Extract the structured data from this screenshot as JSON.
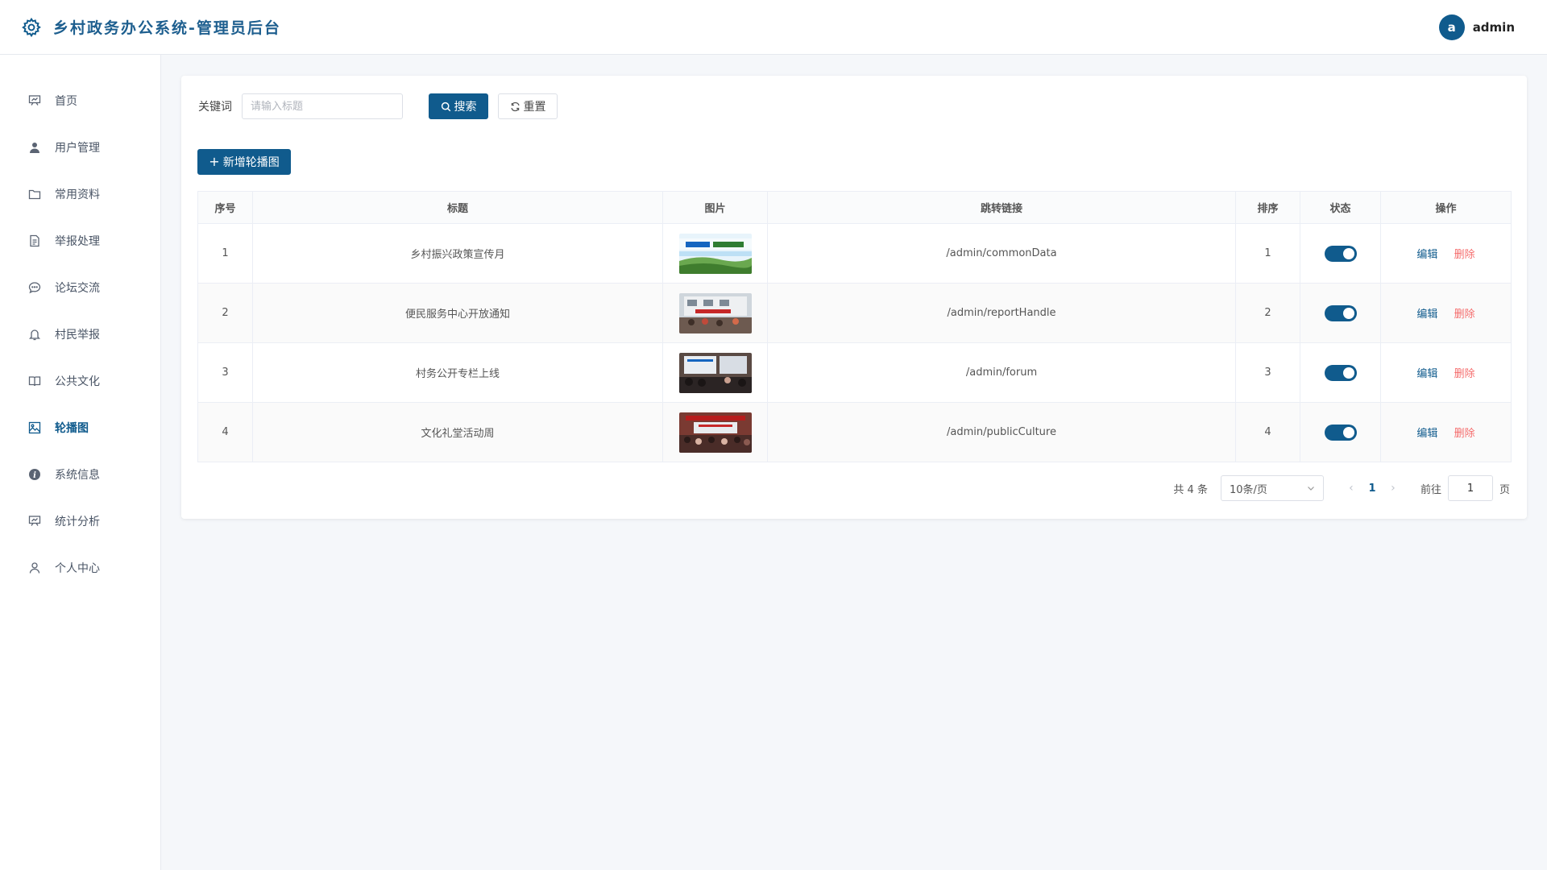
{
  "header": {
    "title": "乡村政务办公系统-管理员后台",
    "avatar_letter": "a",
    "username": "admin"
  },
  "sidebar": {
    "items": [
      {
        "label": "首页",
        "icon": "presentation-board-icon",
        "active": false
      },
      {
        "label": "用户管理",
        "icon": "user-filled-icon",
        "active": false
      },
      {
        "label": "常用资料",
        "icon": "folder-icon",
        "active": false
      },
      {
        "label": "举报处理",
        "icon": "document-icon",
        "active": false
      },
      {
        "label": "论坛交流",
        "icon": "chat-bubble-icon",
        "active": false
      },
      {
        "label": "村民举报",
        "icon": "bell-icon",
        "active": false
      },
      {
        "label": "公共文化",
        "icon": "book-icon",
        "active": false
      },
      {
        "label": "轮播图",
        "icon": "picture-icon",
        "active": true
      },
      {
        "label": "系统信息",
        "icon": "info-circle-icon",
        "active": false
      },
      {
        "label": "统计分析",
        "icon": "presentation-board-icon",
        "active": false
      },
      {
        "label": "个人中心",
        "icon": "user-outline-icon",
        "active": false
      }
    ]
  },
  "search": {
    "label": "关键词",
    "placeholder": "请输入标题",
    "value": "",
    "search_button": "搜索",
    "reset_button": "重置"
  },
  "toolbar": {
    "add_button": "新增轮播图"
  },
  "table": {
    "columns": [
      "序号",
      "标题",
      "图片",
      "跳转链接",
      "排序",
      "状态",
      "操作"
    ],
    "rows": [
      {
        "index": "1",
        "title": "乡村振兴政策宣传月",
        "image": "banner-policy",
        "link": "/admin/commonData",
        "sort": "1",
        "enabled": true
      },
      {
        "index": "2",
        "title": "便民服务中心开放通知",
        "image": "banner-service",
        "link": "/admin/reportHandle",
        "sort": "2",
        "enabled": true
      },
      {
        "index": "3",
        "title": "村务公开专栏上线",
        "image": "banner-meeting",
        "link": "/admin/forum",
        "sort": "3",
        "enabled": true
      },
      {
        "index": "4",
        "title": "文化礼堂活动周",
        "image": "banner-hall",
        "link": "/admin/publicCulture",
        "sort": "4",
        "enabled": true
      }
    ],
    "edit_label": "编辑",
    "delete_label": "删除"
  },
  "pagination": {
    "total_text": "共 4 条",
    "page_size": "10条/页",
    "current_page": "1",
    "goto_label": "前往",
    "goto_value": "1",
    "page_unit": "页"
  },
  "colors": {
    "primary": "#105b8d",
    "danger": "#f56c6c"
  }
}
